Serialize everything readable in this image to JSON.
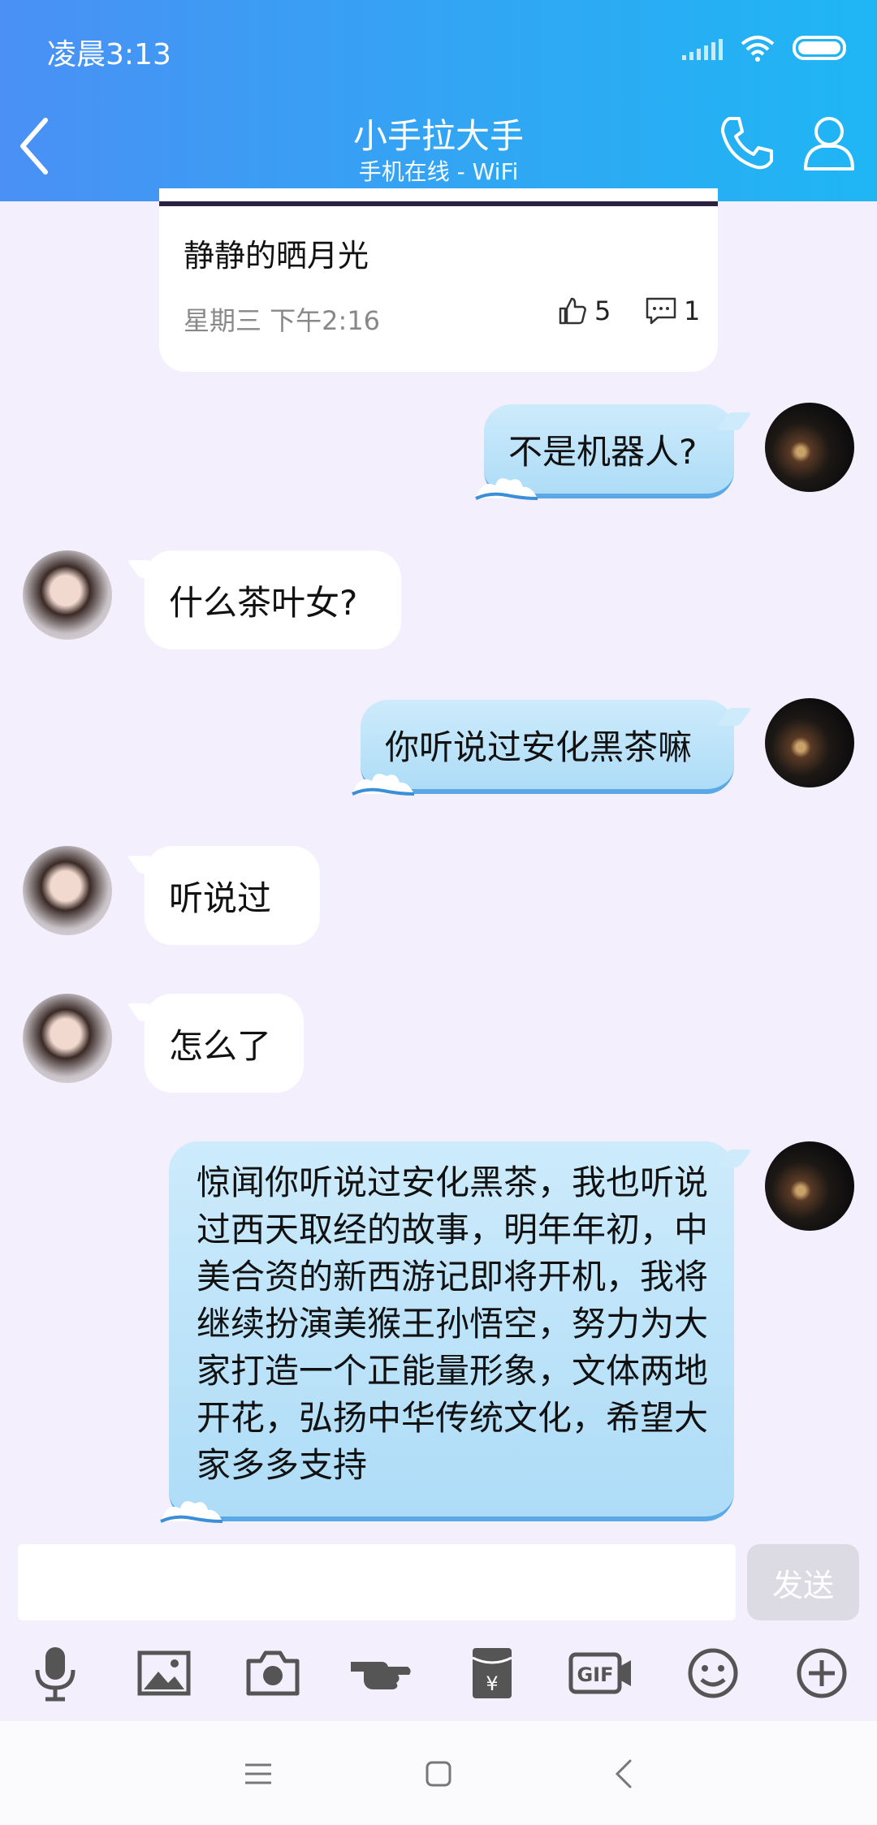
{
  "status_bar": {
    "time": "凌晨3:13"
  },
  "header": {
    "title": "小手拉大手",
    "subtitle": "手机在线 - WiFi"
  },
  "feed_card": {
    "text": "静静的晒月光",
    "time": "星期三 下午2:16",
    "likes": "5",
    "comments": "1"
  },
  "messages": [
    {
      "from": "me",
      "text": "不是机器人?"
    },
    {
      "from": "friend",
      "text": "什么茶叶女?"
    },
    {
      "from": "me",
      "text": "你听说过安化黑茶嘛"
    },
    {
      "from": "friend",
      "text": "听说过"
    },
    {
      "from": "friend",
      "text": "怎么了"
    },
    {
      "from": "me",
      "text": "惊闻你听说过安化黑茶，我也听说过西天取经的故事，明年年初，中美合资的新西游记即将开机，我将继续扮演美猴王孙悟空，努力为大家打造一个正能量形象，文体两地开花，弘扬中华传统文化，希望大家多多支持"
    }
  ],
  "input_bar": {
    "value": "",
    "send_label": "发送"
  },
  "toolbar_icons": [
    "microphone-icon",
    "image-icon",
    "camera-icon",
    "poke-icon",
    "red-packet-icon",
    "gif-icon",
    "emoji-icon",
    "plus-icon"
  ],
  "red_packet_symbol": "¥",
  "gif_label": "GIF",
  "colors": {
    "header_start": "#4a90f5",
    "header_end": "#1fb6f4",
    "chat_background": "#f3effc",
    "outgoing_bubble": "#aedcf7",
    "incoming_bubble": "#ffffff"
  }
}
